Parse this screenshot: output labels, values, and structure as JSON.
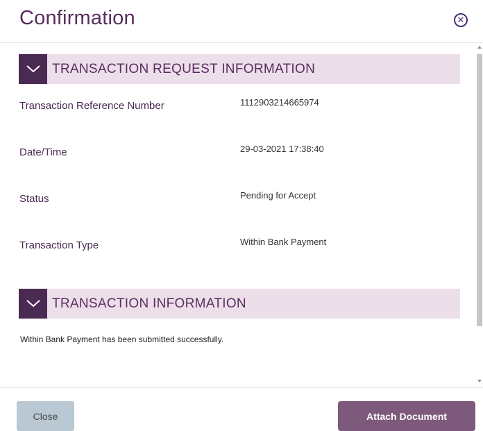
{
  "dialog": {
    "title": "Confirmation",
    "close_icon": "close-circle-icon"
  },
  "sections": {
    "request": {
      "title": "TRANSACTION REQUEST INFORMATION",
      "icon": "chevron-down-icon",
      "rows": [
        {
          "label": "Transaction Reference Number",
          "value": "1112903214665974"
        },
        {
          "label": "Date/Time",
          "value": "29-03-2021 17:38:40"
        },
        {
          "label": "Status",
          "value": "Pending for Accept"
        },
        {
          "label": "Transaction Type",
          "value": "Within Bank Payment"
        }
      ]
    },
    "transaction": {
      "title": "TRANSACTION INFORMATION",
      "icon": "chevron-down-icon",
      "message": "Within Bank Payment has been submitted successfully."
    }
  },
  "footer": {
    "close_label": "Close",
    "attach_label": "Attach Document"
  },
  "colors": {
    "accent": "#4a2a52",
    "section_bg": "#ecdfea",
    "primary_button": "#7d5a7b",
    "secondary_button": "#b9c8d2"
  }
}
